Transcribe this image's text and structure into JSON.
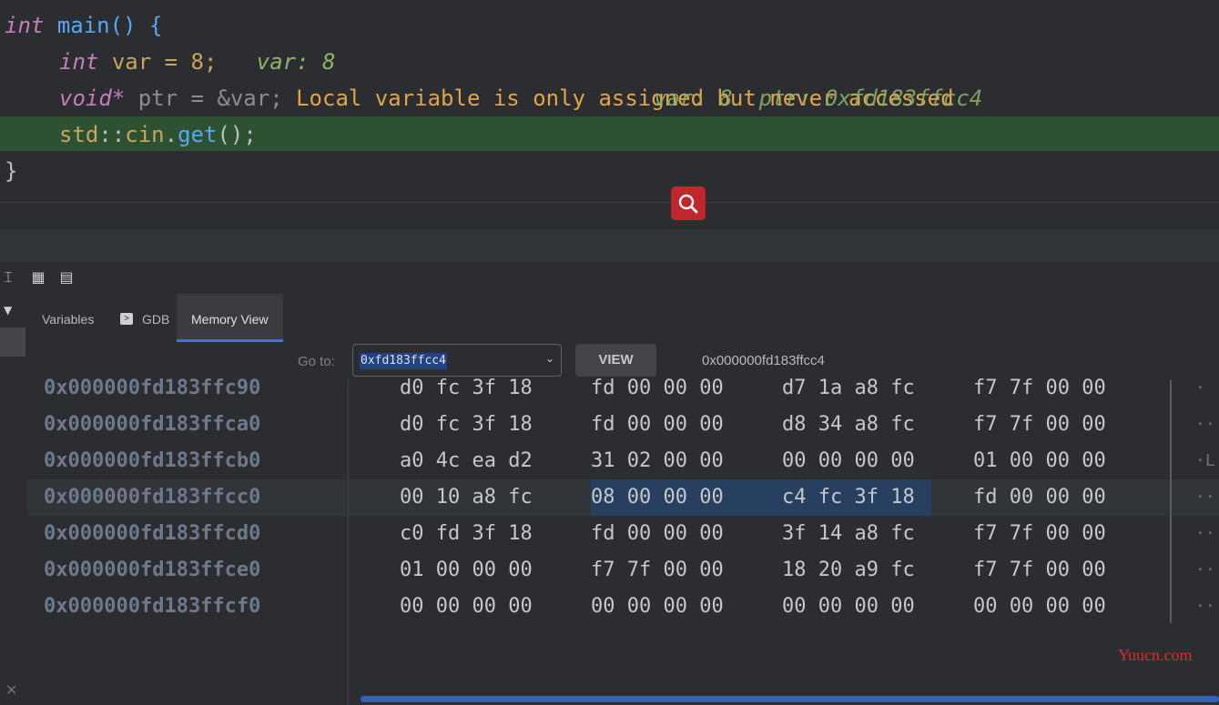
{
  "editor": {
    "lines": [
      {
        "kw": "int",
        "rest": "main() {"
      },
      {
        "kw": "int",
        "code": "var = 8;",
        "hint": "var: 8"
      },
      {
        "kw": "void*",
        "code": "ptr = &var;",
        "warning": "Local variable is only assigned but never accessed",
        "hint": "var: 8  ptr: 0xfd183ffcc4"
      },
      {
        "ns": "std",
        "sep1": "::",
        "obj": "cin",
        "dot": ".",
        "fn": "get",
        "tail": "();"
      },
      {
        "close": "}"
      }
    ]
  },
  "panel": {
    "tabs": [
      {
        "label": "Variables"
      },
      {
        "label": "GDB"
      },
      {
        "label": "Memory View"
      }
    ],
    "active_tab": "Memory View",
    "goto_label": "Go to:",
    "goto_value": "0xfd183ffcc4",
    "view_button": "VIEW",
    "address_readout": "0x000000fd183ffcc4"
  },
  "memory": {
    "rows": [
      {
        "address": "0x000000fd183ffc90",
        "groups": [
          "d0 fc 3f 18",
          "fd 00 00 00",
          "d7 1a a8 fc",
          "f7 7f 00 00"
        ],
        "ascii": "·"
      },
      {
        "address": "0x000000fd183ffca0",
        "groups": [
          "d0 fc 3f 18",
          "fd 00 00 00",
          "d8 34 a8 fc",
          "f7 7f 00 00"
        ],
        "ascii": "··"
      },
      {
        "address": "0x000000fd183ffcb0",
        "groups": [
          "a0 4c ea d2",
          "31 02 00 00",
          "00 00 00 00",
          "01 00 00 00"
        ],
        "ascii": "·L"
      },
      {
        "address": "0x000000fd183ffcc0",
        "groups": [
          "00 10 a8 fc",
          "08 00 00 00",
          "c4 fc 3f 18",
          "fd 00 00 00"
        ],
        "ascii": "··"
      },
      {
        "address": "0x000000fd183ffcd0",
        "groups": [
          "c0 fd 3f 18",
          "fd 00 00 00",
          "3f 14 a8 fc",
          "f7 7f 00 00"
        ],
        "ascii": "··"
      },
      {
        "address": "0x000000fd183ffce0",
        "groups": [
          "01 00 00 00",
          "f7 7f 00 00",
          "18 20 a9 fc",
          "f7 7f 00 00"
        ],
        "ascii": "··"
      },
      {
        "address": "0x000000fd183ffcf0",
        "groups": [
          "00 00 00 00",
          "00 00 00 00",
          "00 00 00 00",
          "00 00 00 00"
        ],
        "ascii": "··"
      }
    ]
  },
  "watermark": "Yuucn.com",
  "colors": {
    "accent": "#3574f0",
    "current_line": "#2e5132",
    "search_button": "#c0272d"
  }
}
